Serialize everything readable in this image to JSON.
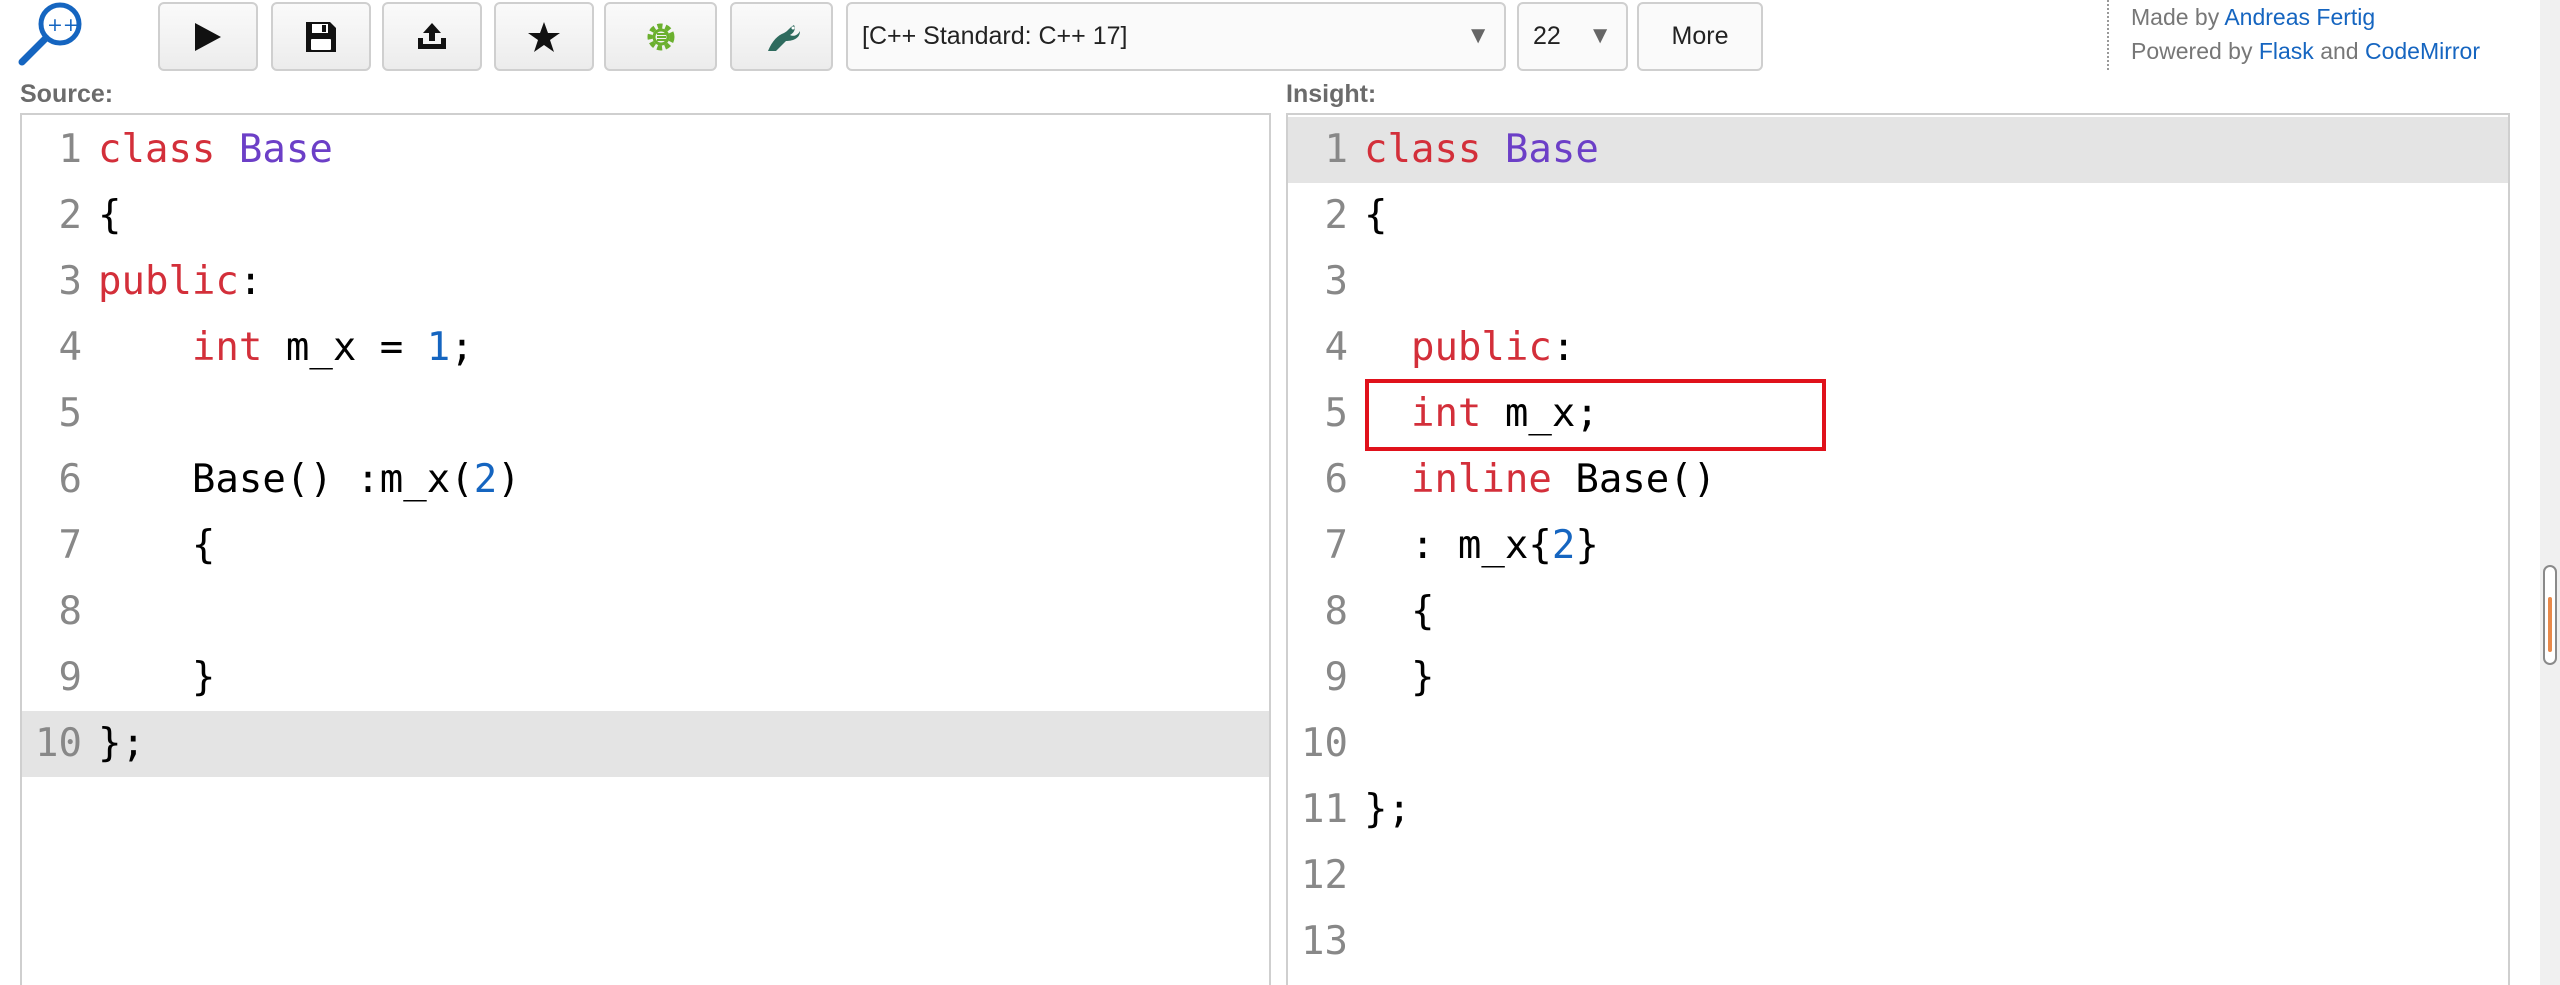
{
  "toolbar": {
    "buttons": [
      {
        "name": "run-button",
        "icon": "play-icon"
      },
      {
        "name": "save-button",
        "icon": "floppy-disk-icon"
      },
      {
        "name": "share-button",
        "icon": "upload-icon"
      },
      {
        "name": "favorite-button",
        "icon": "star-icon"
      },
      {
        "name": "cppinsights-button",
        "icon": "gear-c-icon"
      },
      {
        "name": "compiler-explorer-button",
        "icon": "dragon-icon"
      }
    ],
    "standard_select": {
      "value": "[C++ Standard: C++ 17]"
    },
    "font_size_select": {
      "value": "22"
    },
    "more_label": "More"
  },
  "credits": {
    "made_by_prefix": "Made by",
    "author": "Andreas Fertig",
    "powered_by_prefix": "Powered by",
    "flask": "Flask",
    "and_word": "and",
    "codemirror": "CodeMirror"
  },
  "source": {
    "label": "Source:",
    "active_line": 10,
    "lines": [
      {
        "n": "1",
        "parts": [
          {
            "t": "class",
            "c": "kw"
          },
          {
            "t": " "
          },
          {
            "t": "Base",
            "c": "def"
          }
        ]
      },
      {
        "n": "2",
        "parts": [
          {
            "t": "{"
          }
        ]
      },
      {
        "n": "3",
        "parts": [
          {
            "t": "public",
            "c": "kw"
          },
          {
            "t": ":"
          }
        ]
      },
      {
        "n": "4",
        "parts": [
          {
            "t": "    "
          },
          {
            "t": "int",
            "c": "kw"
          },
          {
            "t": " m_x = "
          },
          {
            "t": "1",
            "c": "num"
          },
          {
            "t": ";"
          }
        ]
      },
      {
        "n": "5",
        "parts": []
      },
      {
        "n": "6",
        "parts": [
          {
            "t": "    Base() :m_x("
          },
          {
            "t": "2",
            "c": "num"
          },
          {
            "t": ")"
          }
        ]
      },
      {
        "n": "7",
        "parts": [
          {
            "t": "    {"
          }
        ]
      },
      {
        "n": "8",
        "parts": []
      },
      {
        "n": "9",
        "parts": [
          {
            "t": "    }"
          }
        ]
      },
      {
        "n": "10",
        "parts": [
          {
            "t": "};"
          }
        ]
      }
    ]
  },
  "insight": {
    "label": "Insight:",
    "active_line": 1,
    "highlighted_line": 5,
    "lines": [
      {
        "n": "1",
        "parts": [
          {
            "t": "class",
            "c": "kw"
          },
          {
            "t": " "
          },
          {
            "t": "Base",
            "c": "def"
          }
        ]
      },
      {
        "n": "2",
        "parts": [
          {
            "t": "{"
          }
        ]
      },
      {
        "n": "3",
        "parts": []
      },
      {
        "n": "4",
        "parts": [
          {
            "t": "  "
          },
          {
            "t": "public",
            "c": "kw"
          },
          {
            "t": ":"
          }
        ]
      },
      {
        "n": "5",
        "parts": [
          {
            "t": "  "
          },
          {
            "t": "int",
            "c": "kw"
          },
          {
            "t": " m_x;"
          }
        ]
      },
      {
        "n": "6",
        "parts": [
          {
            "t": "  "
          },
          {
            "t": "inline",
            "c": "kw"
          },
          {
            "t": " Base()"
          }
        ]
      },
      {
        "n": "7",
        "parts": [
          {
            "t": "  : m_x{"
          },
          {
            "t": "2",
            "c": "num"
          },
          {
            "t": "}"
          }
        ]
      },
      {
        "n": "8",
        "parts": [
          {
            "t": "  {"
          }
        ]
      },
      {
        "n": "9",
        "parts": [
          {
            "t": "  }"
          }
        ]
      },
      {
        "n": "10",
        "parts": []
      },
      {
        "n": "11",
        "parts": [
          {
            "t": "};"
          }
        ]
      },
      {
        "n": "12",
        "parts": []
      },
      {
        "n": "13",
        "parts": []
      }
    ]
  },
  "colors": {
    "keyword": "#d32f3a",
    "definition": "#6c3fc7",
    "number": "#1565c0",
    "highlight_box": "#e0111b",
    "active_line_bg": "#e4e4e4"
  }
}
